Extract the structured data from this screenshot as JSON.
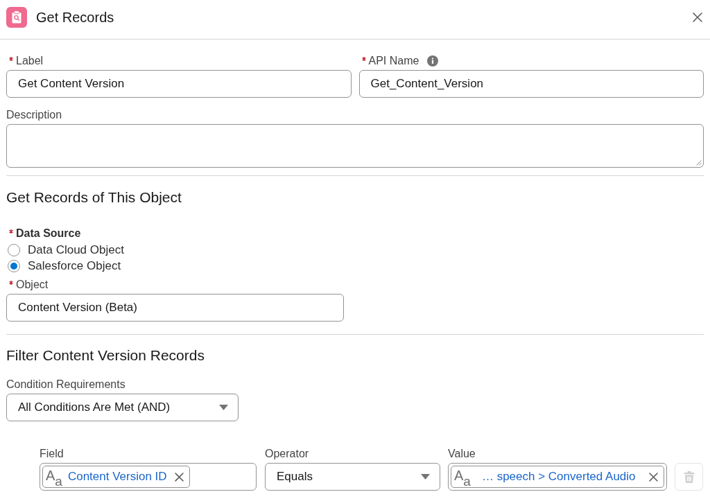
{
  "modal": {
    "title": "Get Records"
  },
  "properties": {
    "label": {
      "label": "Label",
      "required": true,
      "value": "Get Content Version"
    },
    "api_name": {
      "label": "API Name",
      "required": true,
      "value": "Get_Content_Version"
    },
    "description": {
      "label": "Description"
    }
  },
  "object_section": {
    "title": "Get Records of This Object",
    "data_source": {
      "label": "Data Source",
      "required": true,
      "options": [
        {
          "label": "Data Cloud Object",
          "selected": false
        },
        {
          "label": "Salesforce Object",
          "selected": true
        }
      ]
    },
    "object": {
      "label": "Object",
      "required": true,
      "value": "Content Version (Beta)"
    }
  },
  "filter_section": {
    "title": "Filter Content Version Records",
    "condition_requirements": {
      "label": "Condition Requirements",
      "value": "All Conditions Are Met (AND)"
    },
    "conditions": [
      {
        "field": {
          "label": "Field",
          "type_icon": "A$_{a}$",
          "value": "Content Version ID"
        },
        "operator": {
          "label": "Operator",
          "value": "Equals"
        },
        "value": {
          "label": "Value",
          "type_icon": "A$_{a}$",
          "value": "… speech > Converted Audio"
        },
        "delete_button": {
          "disabled": true
        }
      }
    ]
  }
}
